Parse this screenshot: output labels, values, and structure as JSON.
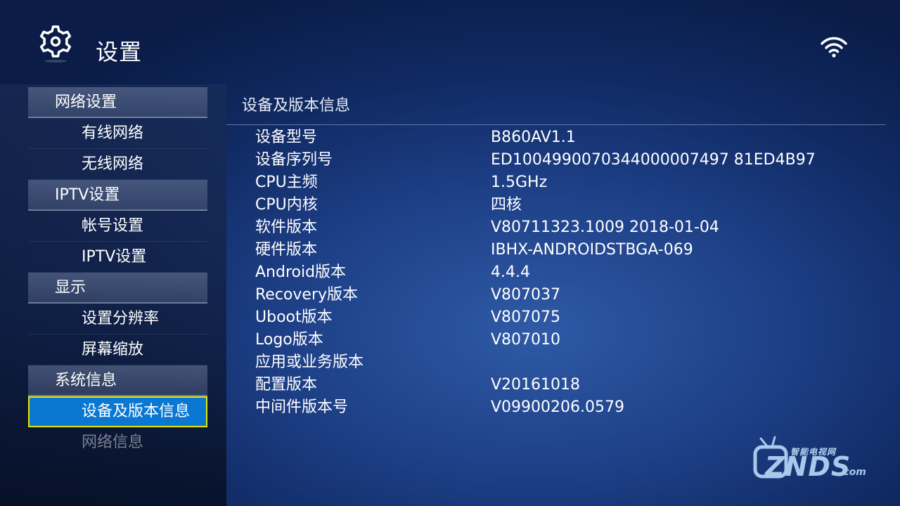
{
  "header": {
    "title": "设置",
    "settings_icon": "gear-icon",
    "status_icon": "wifi-icon"
  },
  "sidebar": {
    "items": [
      {
        "label": "网络设置",
        "type": "section"
      },
      {
        "label": "有线网络",
        "type": "sub"
      },
      {
        "label": "无线网络",
        "type": "sub"
      },
      {
        "label": "IPTV设置",
        "type": "section"
      },
      {
        "label": "帐号设置",
        "type": "sub"
      },
      {
        "label": "IPTV设置",
        "type": "sub"
      },
      {
        "label": "显示",
        "type": "section"
      },
      {
        "label": "设置分辨率",
        "type": "sub"
      },
      {
        "label": "屏幕缩放",
        "type": "sub"
      },
      {
        "label": "系统信息",
        "type": "section"
      },
      {
        "label": "设备及版本信息",
        "type": "sub",
        "selected": true
      },
      {
        "label": "网络信息",
        "type": "sub"
      }
    ]
  },
  "panel": {
    "title": "设备及版本信息",
    "rows": [
      {
        "label": "设备型号",
        "value": "B860AV1.1"
      },
      {
        "label": "设备序列号",
        "value": "ED1004990070344000007497 81ED4B97"
      },
      {
        "label": "CPU主频",
        "value": "1.5GHz"
      },
      {
        "label": "CPU内核",
        "value": "四核"
      },
      {
        "label": "软件版本",
        "value": "V80711323.1009 2018-01-04"
      },
      {
        "label": "硬件版本",
        "value": "IBHX-ANDROIDSTBGA-069"
      },
      {
        "label": "Android版本",
        "value": "4.4.4"
      },
      {
        "label": "Recovery版本",
        "value": "V807037"
      },
      {
        "label": "Uboot版本",
        "value": "V807075"
      },
      {
        "label": "Logo版本",
        "value": "V807010"
      },
      {
        "label": "应用或业务版本",
        "value": ""
      },
      {
        "label": "配置版本",
        "value": "V20161018"
      },
      {
        "label": "中间件版本号",
        "value": "V09900206.0579"
      }
    ]
  },
  "watermark": {
    "cn": "智能电视网",
    "brand": "ZNDS",
    "domain": ".com"
  },
  "colors": {
    "selected_bg": "#0a77d2",
    "selected_border": "#e6e600"
  }
}
